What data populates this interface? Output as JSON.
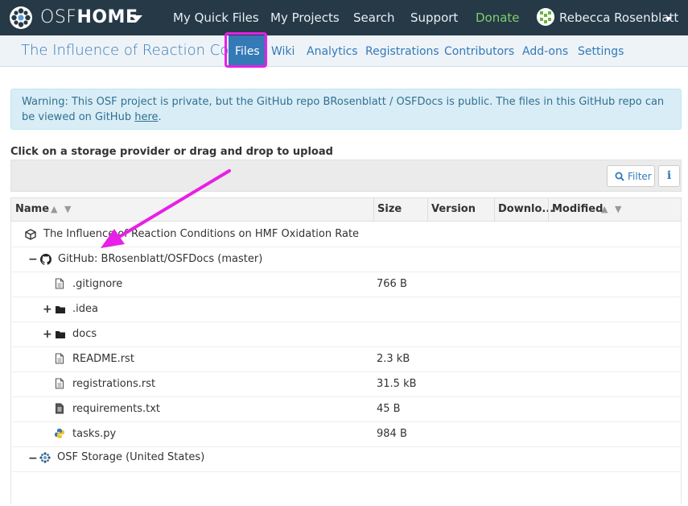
{
  "nav": {
    "brand_osf": "OSF",
    "brand_home": "HOME",
    "links": [
      "My Quick Files",
      "My Projects",
      "Search",
      "Support",
      "Donate"
    ],
    "user_name": "Rebecca Rosenblatt"
  },
  "project": {
    "title": "The Influence of Reaction Co...",
    "tabs": [
      "Files",
      "Wiki",
      "Analytics",
      "Registrations",
      "Contributors",
      "Add-ons",
      "Settings"
    ],
    "active_tab": "Files"
  },
  "alert": {
    "text": "Warning: This OSF project is private, but the GitHub repo BRosenblatt / OSFDocs is public. The files in this GitHub repo can be viewed on GitHub ",
    "link": "here",
    "end": "."
  },
  "upload_hint": "Click on a storage provider or drag and drop to upload",
  "toolbar": {
    "filter_label": "Filter",
    "info_label": "i"
  },
  "table": {
    "columns": [
      "Name",
      "Size",
      "Version",
      "Downlo...",
      "Modified"
    ],
    "rows": [
      {
        "name": "The Influence of Reaction Conditions on HMF Oxidation Rate",
        "size": "",
        "icon": "project-cube-icon",
        "toggle": ""
      },
      {
        "name": "GitHub: BRosenblatt/OSFDocs (master)",
        "size": "",
        "icon": "github-icon",
        "toggle": "−"
      },
      {
        "name": ".gitignore",
        "size": "766 B",
        "icon": "file-icon",
        "toggle": ""
      },
      {
        "name": ".idea",
        "size": "",
        "icon": "folder-icon",
        "toggle": "+"
      },
      {
        "name": "docs",
        "size": "",
        "icon": "folder-icon",
        "toggle": "+"
      },
      {
        "name": "README.rst",
        "size": "2.3 kB",
        "icon": "file-icon",
        "toggle": ""
      },
      {
        "name": "registrations.rst",
        "size": "31.5 kB",
        "icon": "file-icon",
        "toggle": ""
      },
      {
        "name": "requirements.txt",
        "size": "45 B",
        "icon": "text-file-icon",
        "toggle": ""
      },
      {
        "name": "tasks.py",
        "size": "984 B",
        "icon": "python-file-icon",
        "toggle": ""
      },
      {
        "name": "OSF Storage (United States)",
        "size": "",
        "icon": "osf-storage-icon",
        "toggle": "−"
      }
    ]
  },
  "colors": {
    "navbar": "#263947",
    "link": "#337ab7",
    "donate": "#7fcf6f",
    "annotation": "#e81fe6",
    "alert_bg": "#d9edf7"
  }
}
